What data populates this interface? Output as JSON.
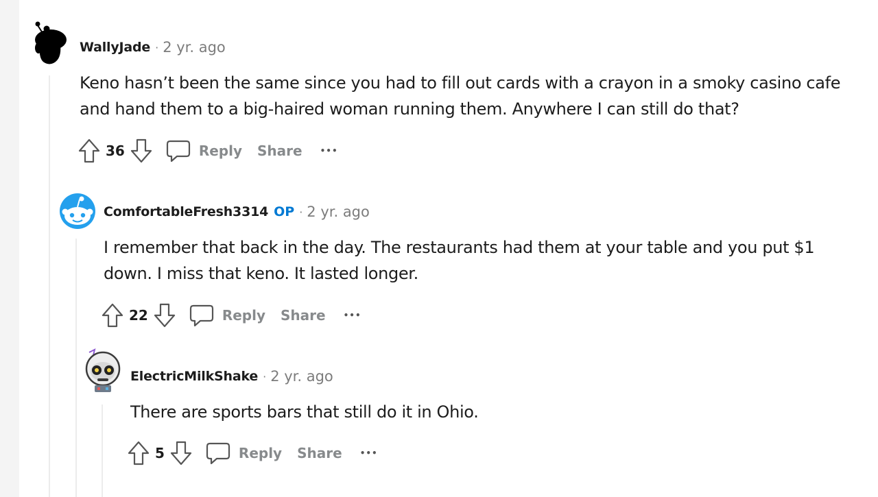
{
  "comments": [
    {
      "username": "WallyJade",
      "op_badge": "",
      "separator": "·",
      "age": "2 yr. ago",
      "body_lines": [
        "Keno hasn’t been the same since you had to fill out cards with a crayon in a smoky casino cafe",
        "and hand them to a big-haired woman running them. Anywhere I can still do that?"
      ],
      "votes": "36",
      "reply_label": "Reply",
      "share_label": "Share",
      "more_label": "•••"
    },
    {
      "username": "ComfortableFresh3314",
      "op_badge": "OP",
      "separator": "·",
      "age": "2 yr. ago",
      "body_lines": [
        "I remember that back in the day. The restaurants had them at your table and you put $1",
        "down. I miss that keno. It lasted longer."
      ],
      "votes": "22",
      "reply_label": "Reply",
      "share_label": "Share",
      "more_label": "•••"
    },
    {
      "username": "ElectricMilkShake",
      "op_badge": "",
      "separator": "·",
      "age": "2 yr. ago",
      "body_lines": [
        "There are sports bars that still do it in Ohio."
      ],
      "votes": "5",
      "reply_label": "Reply",
      "share_label": "Share",
      "more_label": "•••"
    }
  ],
  "colors": {
    "page_bg": "#f4f4f4",
    "panel_bg": "#ffffff",
    "text": "#1c1c1c",
    "meta": "#7c7c7c",
    "action": "#878a8c",
    "op_blue": "#0079d3",
    "thread_line": "#ececec"
  }
}
